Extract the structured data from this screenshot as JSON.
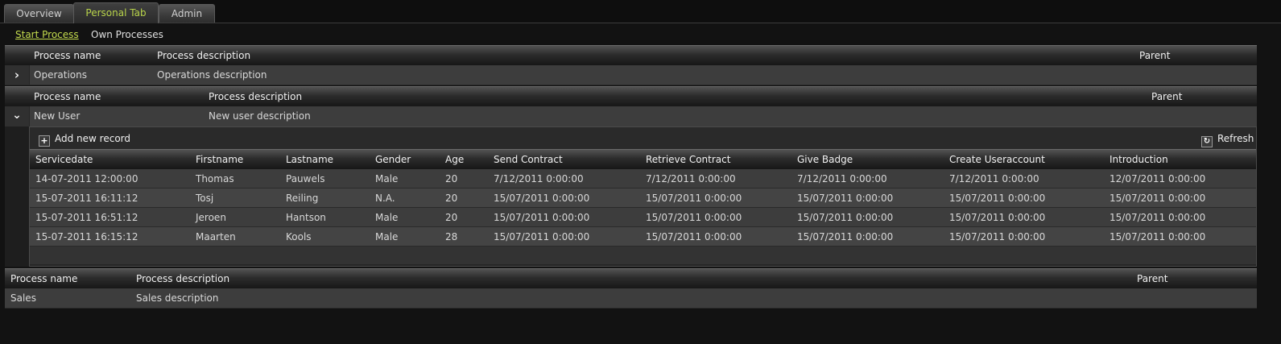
{
  "tabs": [
    "Overview",
    "Personal Tab",
    "Admin"
  ],
  "sublinks": [
    "Start Process",
    "Own Processes"
  ],
  "outer_columns": {
    "name": "Process name",
    "description": "Process description",
    "parent": "Parent"
  },
  "group1": {
    "name": "Operations",
    "description": "Operations description",
    "expander": "›"
  },
  "group2": {
    "name": "New User",
    "description": "New user description",
    "expander": "⌄"
  },
  "group3": {
    "name": "Sales",
    "description": "Sales description"
  },
  "toolbar": {
    "add_label": "Add new record",
    "add_icon": "plus-icon",
    "refresh_label": "Refresh",
    "refresh_icon": "refresh-icon"
  },
  "grid": {
    "columns": [
      "Servicedate",
      "Firstname",
      "Lastname",
      "Gender",
      "Age",
      "Send Contract",
      "Retrieve Contract",
      "Give Badge",
      "Create Useraccount",
      "Introduction"
    ],
    "rows": [
      [
        "14-07-2011 12:00:00",
        "Thomas",
        "Pauwels",
        "Male",
        "20",
        "7/12/2011 0:00:00",
        "7/12/2011 0:00:00",
        "7/12/2011 0:00:00",
        "7/12/2011 0:00:00",
        "12/07/2011 0:00:00"
      ],
      [
        "15-07-2011 16:11:12",
        "Tosj",
        "Reiling",
        "N.A.",
        "20",
        "15/07/2011 0:00:00",
        "15/07/2011 0:00:00",
        "15/07/2011 0:00:00",
        "15/07/2011 0:00:00",
        "15/07/2011 0:00:00"
      ],
      [
        "15-07-2011 16:51:12",
        "Jeroen",
        "Hantson",
        "Male",
        "20",
        "15/07/2011 0:00:00",
        "15/07/2011 0:00:00",
        "15/07/2011 0:00:00",
        "15/07/2011 0:00:00",
        "15/07/2011 0:00:00"
      ],
      [
        "15-07-2011 16:15:12",
        "Maarten",
        "Kools",
        "Male",
        "28",
        "15/07/2011 0:00:00",
        "15/07/2011 0:00:00",
        "15/07/2011 0:00:00",
        "15/07/2011 0:00:00",
        "15/07/2011 0:00:00"
      ]
    ]
  },
  "colors": {
    "accent": "#b8d34a",
    "background": "#121212",
    "row": "#3d3d3d",
    "row_alt": "#444444"
  }
}
